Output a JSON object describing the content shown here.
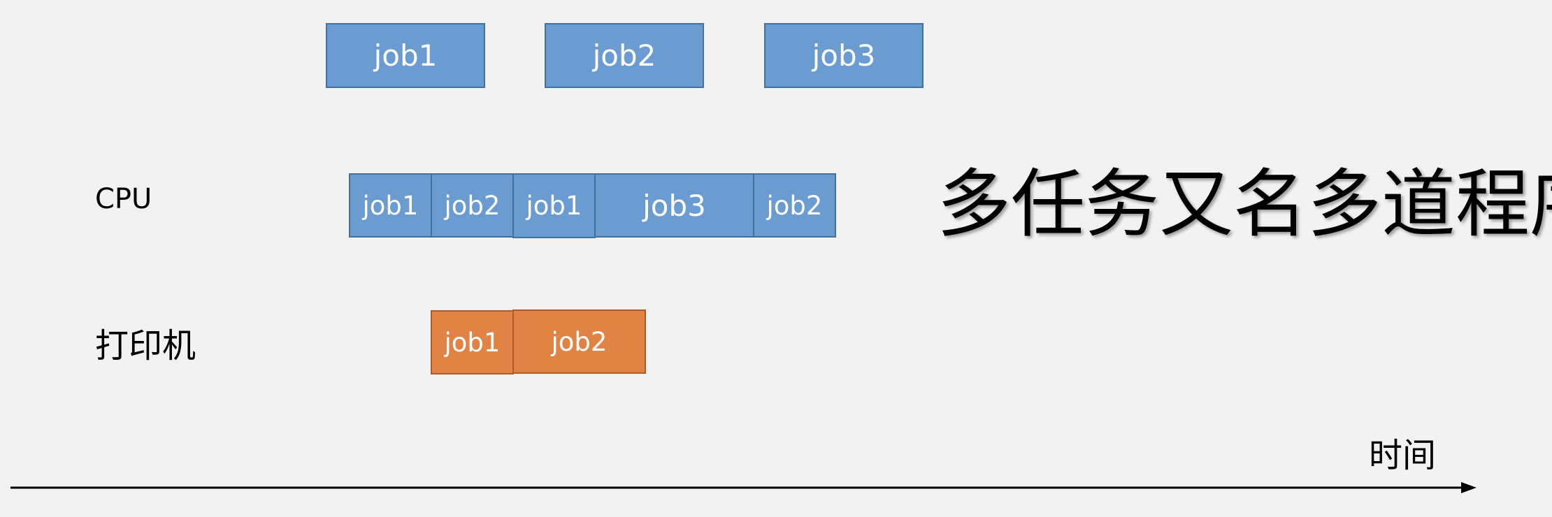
{
  "title": "多任务又名多道程序",
  "labels": {
    "cpu": "CPU",
    "printer": "打印机",
    "time": "时间"
  },
  "top_jobs": [
    "job1",
    "job2",
    "job3"
  ],
  "cpu_jobs": [
    "job1",
    "job2",
    "job1",
    "job3",
    "job2"
  ],
  "printer_jobs": [
    "job1",
    "job2"
  ],
  "colors": {
    "background": "#f2f2f2",
    "job_blue": "#6a9bd1",
    "job_blue_border": "#41719c",
    "job_orange": "#e08344",
    "job_orange_border": "#ae5a21",
    "text": "#000000"
  }
}
